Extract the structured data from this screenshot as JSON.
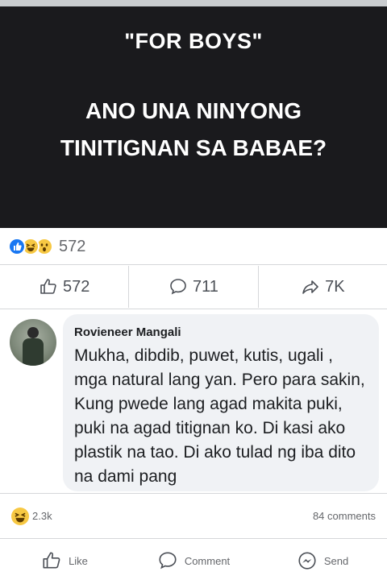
{
  "banner": {
    "line1": "\"FOR BOYS\"",
    "line2": "ANO UNA NINYONG",
    "line3": "TINITIGNAN SA BABAE?",
    "background": "#1a1a1d",
    "text_color": "#ffffff"
  },
  "reactions": {
    "icons": [
      "like-icon",
      "haha-icon",
      "wow-icon"
    ],
    "count": "572"
  },
  "actions": {
    "like_count": "572",
    "comment_count": "711",
    "share_count": "7K"
  },
  "comment": {
    "author": "Rovieneer Mangali",
    "text": "Mukha, dibdib, puwet, kutis, ugali , mga natural lang yan. Pero para sakin, Kung pwede lang agad makita puki, puki na agad titignan ko. Di kasi ako plastik na tao. Di ako tulad ng iba dito na dami pang"
  },
  "stats": {
    "reaction_count": "2.3k",
    "comments": "84 comments"
  },
  "bottom_bar": {
    "like_label": "Like",
    "comment_label": "Comment",
    "send_label": "Send"
  },
  "colors": {
    "accent": "#1877f2",
    "reaction_yellow": "#f7c843",
    "bubble": "#f0f2f5"
  }
}
